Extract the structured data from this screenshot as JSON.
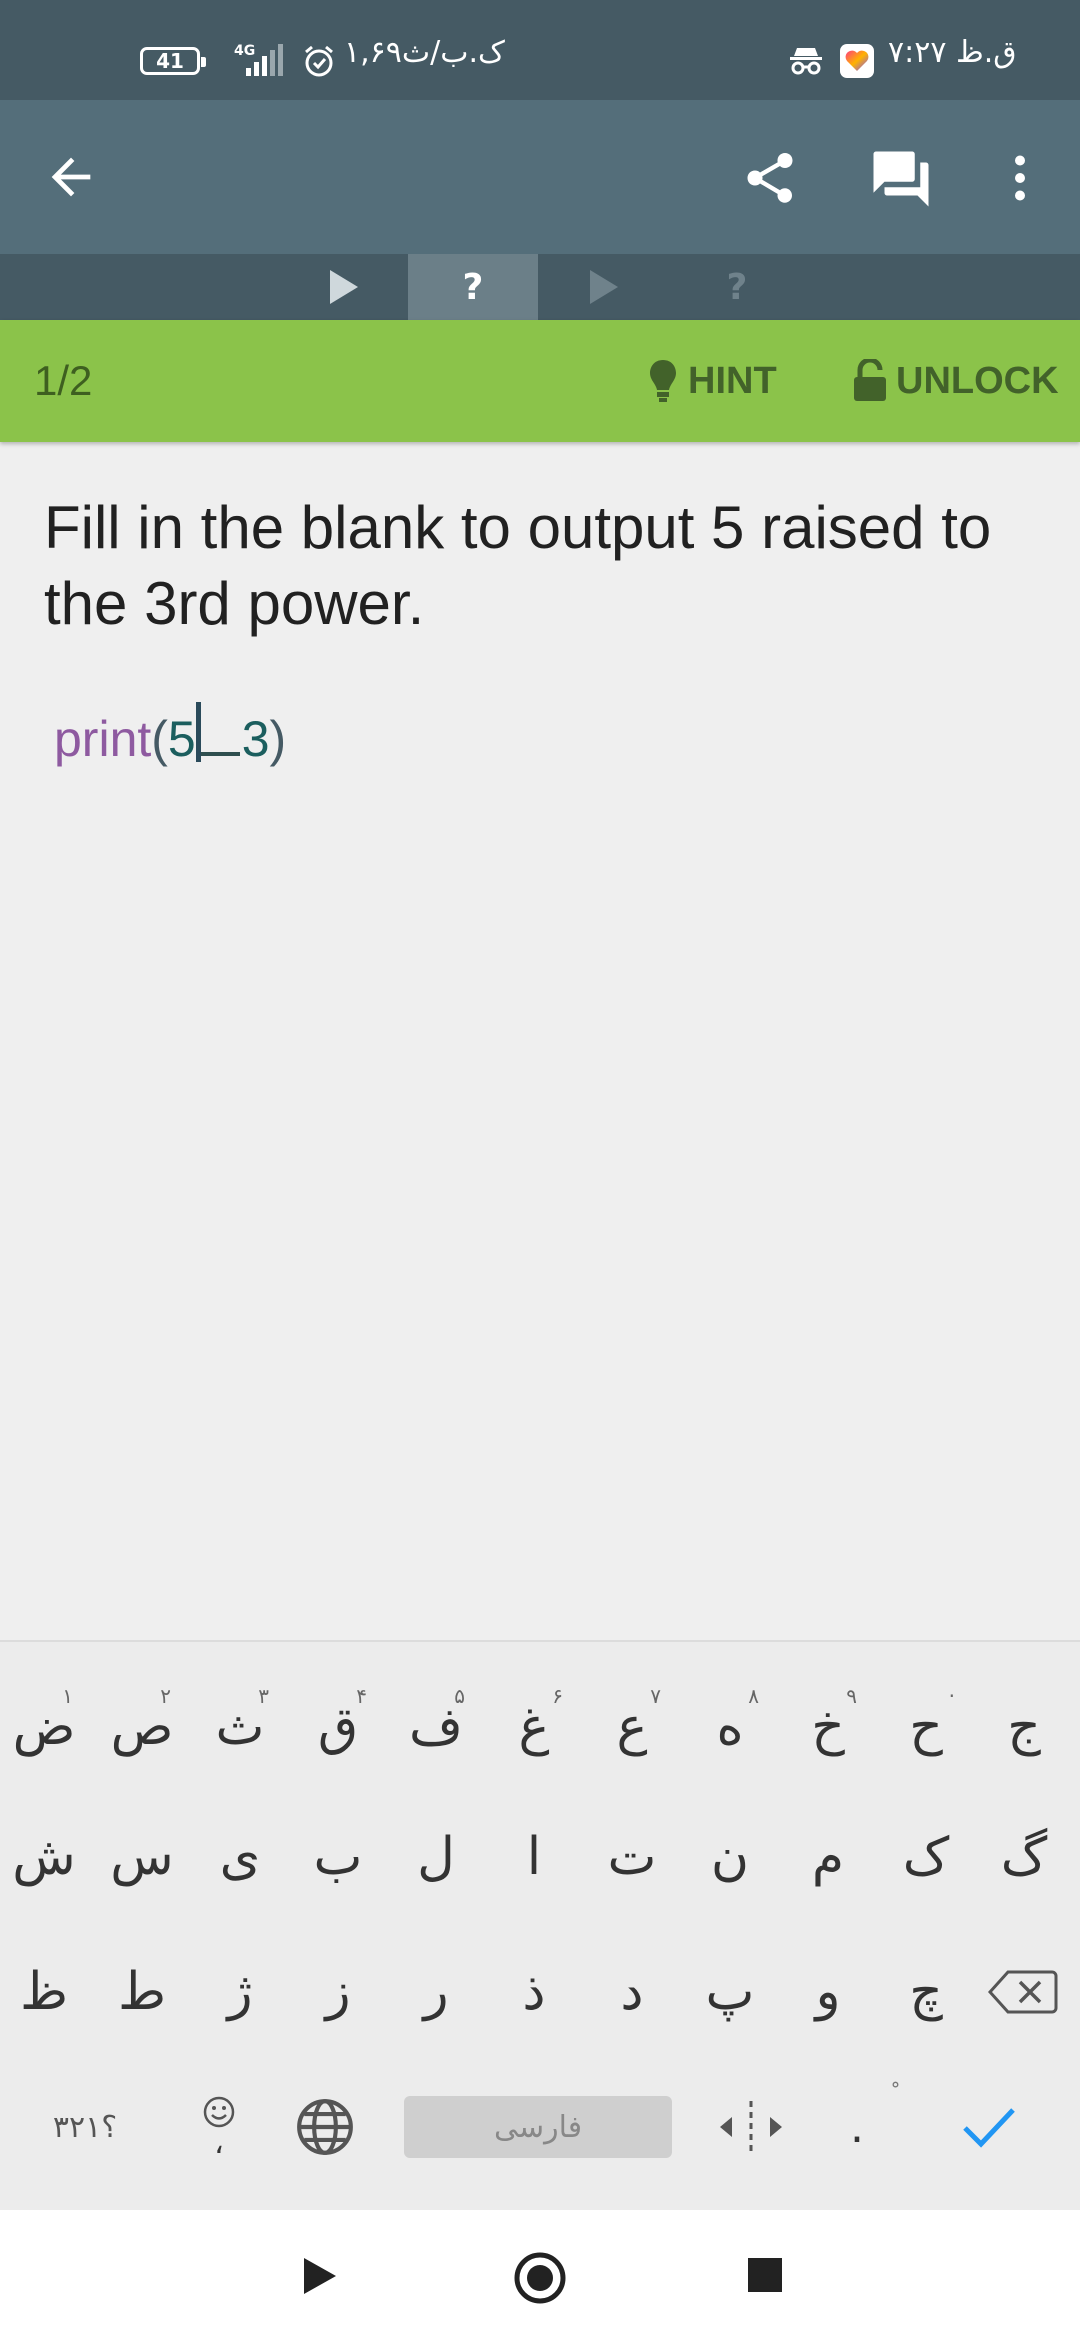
{
  "status_bar": {
    "time": "۷:۲۷ ق.ظ",
    "network_speed": "۱,۶۹ک.ب/ث",
    "battery": "41",
    "network_type": "4G"
  },
  "toolbar": {
    "back_icon": "arrow-left-icon",
    "share_icon": "share-icon",
    "comments_icon": "comments-icon",
    "more_icon": "more-vert-icon"
  },
  "lesson_tabs": [
    {
      "type": "play",
      "label": "",
      "active": false
    },
    {
      "type": "quiz",
      "label": "?",
      "active": true
    },
    {
      "type": "play",
      "label": "",
      "active": false
    },
    {
      "type": "quiz",
      "label": "?",
      "active": false
    }
  ],
  "progress": {
    "count": "1/2",
    "hint_label": "HINT",
    "unlock_label": "UNLOCK",
    "color": "#8bc34a"
  },
  "question": {
    "text": "Fill in the blank to output 5 raised to the 3rd power."
  },
  "code": {
    "func": "print",
    "open": "(",
    "left": "5",
    "right": "3",
    "close": ")"
  },
  "keyboard": {
    "row1": [
      {
        "char": "ج",
        "hint": ""
      },
      {
        "char": "ح",
        "hint": "·"
      },
      {
        "char": "خ",
        "hint": "۹"
      },
      {
        "char": "ه",
        "hint": "۸"
      },
      {
        "char": "ع",
        "hint": "۷"
      },
      {
        "char": "غ",
        "hint": "۶"
      },
      {
        "char": "ف",
        "hint": "۵"
      },
      {
        "char": "ق",
        "hint": "۴"
      },
      {
        "char": "ث",
        "hint": "۳"
      },
      {
        "char": "ص",
        "hint": "۲"
      },
      {
        "char": "ض",
        "hint": "۱"
      }
    ],
    "row2": [
      "گ",
      "ک",
      "م",
      "ن",
      "ت",
      "ا",
      "ل",
      "ب",
      "ی",
      "س",
      "ش"
    ],
    "row3": [
      "چ",
      "و",
      "پ",
      "د",
      "ذ",
      "ر",
      "ز",
      "ژ",
      "ط",
      "ظ"
    ],
    "numbers_key": "؟۳۲۱",
    "emoji_comma": "،",
    "space_label": "فارسی",
    "period": ".",
    "accent_color": "#2196f3"
  }
}
